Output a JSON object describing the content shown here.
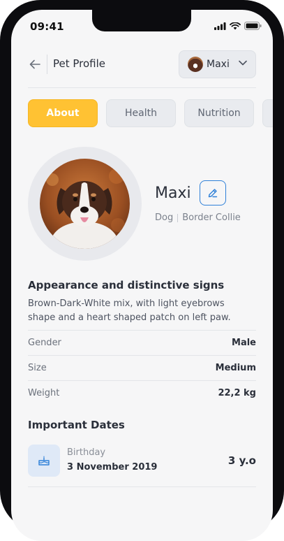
{
  "status_bar": {
    "time": "09:41"
  },
  "header": {
    "title": "Pet Profile",
    "selected_pet": "Maxi"
  },
  "tabs": [
    {
      "label": "About",
      "active": true
    },
    {
      "label": "Health",
      "active": false
    },
    {
      "label": "Nutrition",
      "active": false
    }
  ],
  "profile": {
    "name": "Maxi",
    "species": "Dog",
    "breed": "Border Collie"
  },
  "appearance": {
    "title": "Appearance and distinctive signs",
    "description": "Brown-Dark-White mix, with light eyebrows shape and a heart shaped patch on left paw."
  },
  "attributes": [
    {
      "label": "Gender",
      "value": "Male"
    },
    {
      "label": "Size",
      "value": "Medium"
    },
    {
      "label": "Weight",
      "value": "22,2 kg"
    }
  ],
  "important_dates": {
    "title": "Important Dates",
    "items": [
      {
        "label": "Birthday",
        "date": "3 November 2019",
        "age": "3 y.o",
        "icon": "cake-icon"
      }
    ]
  },
  "colors": {
    "accent": "#ffc233",
    "edit_blue": "#2f80d8",
    "background": "#f6f6f7"
  }
}
